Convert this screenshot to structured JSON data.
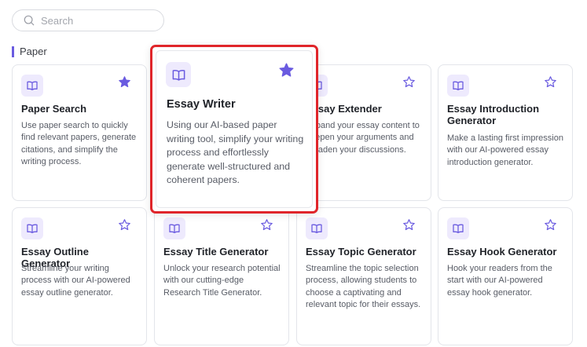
{
  "search": {
    "placeholder": "Search"
  },
  "section": {
    "title": "Paper"
  },
  "accent_color": "#6a5be0",
  "highlight_color": "#e0252a",
  "cards": [
    {
      "title": "Paper Search",
      "desc": "Use paper search to quickly find relevant papers, generate citations, and simplify the writing process.",
      "starred": true,
      "icon": "book-icon"
    },
    {
      "title": "Essay Writer",
      "desc": "Using our AI-based paper writing tool, simplify your writing process and effortlessly generate well-structured and coherent papers.",
      "starred": true,
      "icon": "book-icon"
    },
    {
      "title": "Essay Extender",
      "desc": "Expand your essay content to deepen your arguments and broaden your discussions.",
      "starred": false,
      "icon": "book-icon"
    },
    {
      "title": "Essay Introduction Generator",
      "desc": "Make a lasting first impression with our AI-powered essay introduction generator.",
      "starred": false,
      "icon": "book-icon"
    },
    {
      "title": "Essay Outline Generator",
      "desc": "Streamline your writing process with our AI-powered essay outline generator.",
      "starred": false,
      "icon": "book-icon"
    },
    {
      "title": "Essay Title Generator",
      "desc": "Unlock your research potential with our cutting-edge Research Title Generator.",
      "starred": false,
      "icon": "book-icon"
    },
    {
      "title": "Essay Topic Generator",
      "desc": "Streamline the topic selection process, allowing students to choose a captivating and relevant topic for their essays.",
      "starred": false,
      "icon": "book-icon"
    },
    {
      "title": "Essay Hook Generator",
      "desc": "Hook your readers from the start with our AI-powered essay hook generator.",
      "starred": false,
      "icon": "book-icon"
    }
  ]
}
